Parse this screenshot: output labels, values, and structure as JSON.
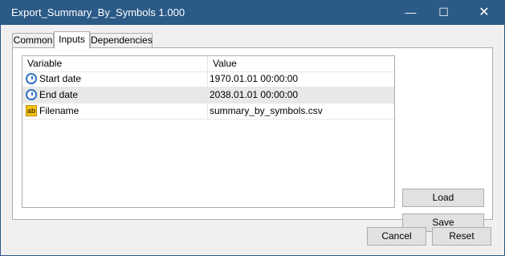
{
  "window": {
    "title": "Export_Summary_By_Symbols 1.000"
  },
  "titlebar_controls": {
    "minimize": "—",
    "maximize": "☐",
    "close": "✕"
  },
  "tabs": [
    {
      "label": "Common"
    },
    {
      "label": "Inputs"
    },
    {
      "label": "Dependencies"
    }
  ],
  "table": {
    "headers": {
      "variable": "Variable",
      "value": "Value"
    },
    "rows": [
      {
        "variable": "Start date",
        "value": "1970.01.01 00:00:00",
        "icon": "clock-icon"
      },
      {
        "variable": "End date",
        "value": "2038.01.01 00:00:00",
        "icon": "clock-icon"
      },
      {
        "variable": "Filename",
        "value": "summary_by_symbols.csv",
        "icon": "string-ab-icon",
        "icon_text": "ab"
      }
    ]
  },
  "buttons": {
    "load": "Load",
    "save": "Save",
    "cancel": "Cancel",
    "reset": "Reset"
  }
}
